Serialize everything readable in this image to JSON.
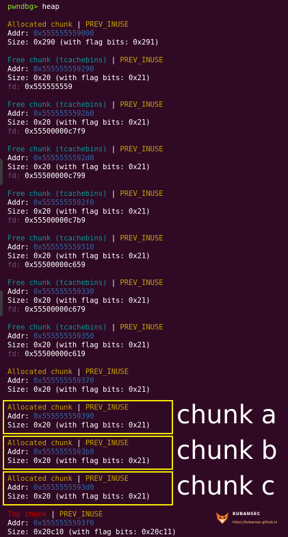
{
  "command_line": {
    "prompt": "pwndbg>",
    "command": "heap"
  },
  "labels": {
    "addr": "Addr:",
    "size": "Size:",
    "fd": "fd:",
    "flag": "PREV_INUSE",
    "separator": "|"
  },
  "chunks": [
    {
      "type": "Allocated chunk",
      "kind": "alloc",
      "addr": "0x555555559000",
      "size": "0x290 (with flag bits: 0x291)",
      "fd": ""
    },
    {
      "type": "Free chunk (tcachebins)",
      "kind": "free",
      "addr": "0x555555559290",
      "size": "0x20 (with flag bits: 0x21)",
      "fd": "0x555555559"
    },
    {
      "type": "Free chunk (tcachebins)",
      "kind": "free",
      "addr": "0x5555555592b0",
      "size": "0x20 (with flag bits: 0x21)",
      "fd": "0x55500000c7f9"
    },
    {
      "type": "Free chunk (tcachebins)",
      "kind": "free",
      "addr": "0x5555555592d0",
      "size": "0x20 (with flag bits: 0x21)",
      "fd": "0x55500000c799"
    },
    {
      "type": "Free chunk (tcachebins)",
      "kind": "free",
      "addr": "0x5555555592f0",
      "size": "0x20 (with flag bits: 0x21)",
      "fd": "0x55500000c7b9"
    },
    {
      "type": "Free chunk (tcachebins)",
      "kind": "free",
      "addr": "0x555555559310",
      "size": "0x20 (with flag bits: 0x21)",
      "fd": "0x55500000c659"
    },
    {
      "type": "Free chunk (tcachebins)",
      "kind": "free",
      "addr": "0x555555559330",
      "size": "0x20 (with flag bits: 0x21)",
      "fd": "0x55500000c679"
    },
    {
      "type": "Free chunk (tcachebins)",
      "kind": "free",
      "addr": "0x555555559350",
      "size": "0x20 (with flag bits: 0x21)",
      "fd": "0x55500000c619"
    },
    {
      "type": "Allocated chunk",
      "kind": "alloc",
      "addr": "0x555555559370",
      "size": "0x20 (with flag bits: 0x21)",
      "fd": ""
    },
    {
      "type": "Allocated chunk",
      "kind": "alloc",
      "addr": "0x555555559390",
      "size": "0x20 (with flag bits: 0x21)",
      "fd": ""
    },
    {
      "type": "Allocated chunk",
      "kind": "alloc",
      "addr": "0x5555555593b0",
      "size": "0x20 (with flag bits: 0x21)",
      "fd": ""
    },
    {
      "type": "Allocated chunk",
      "kind": "alloc",
      "addr": "0x5555555593d0",
      "size": "0x20 (with flag bits: 0x21)",
      "fd": ""
    },
    {
      "type": "Top chunk",
      "kind": "top",
      "addr": "0x5555555593f0",
      "size": "0x20c10 (with flag bits: 0x20c11)",
      "fd": ""
    }
  ],
  "highlights": [
    {
      "chunk": 9,
      "label": "chunk a"
    },
    {
      "chunk": 10,
      "label": "chunk b"
    },
    {
      "chunk": 11,
      "label": "chunk c"
    }
  ],
  "watermark": {
    "name": "KUBANSEC",
    "url": "https://kubansec.github.io"
  },
  "colors": {
    "background": "#300a24",
    "allocated": "#c4a000",
    "free": "#06989a",
    "top": "#cc0000",
    "address": "#3465a4",
    "fd_key": "#75507b",
    "highlight": "#f2e600",
    "prompt": "#8ae234"
  }
}
